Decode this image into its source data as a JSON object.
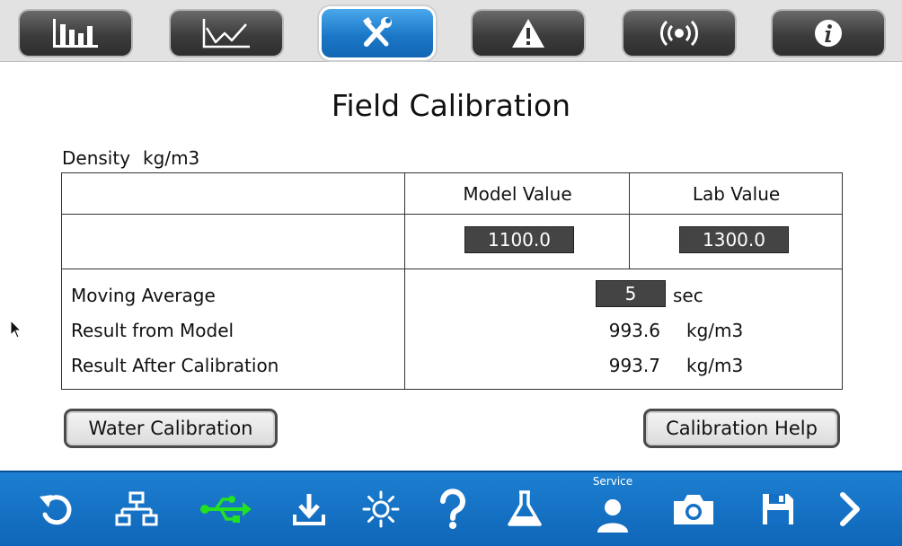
{
  "nav_tabs": [
    {
      "icon": "bar-chart-icon",
      "active": false
    },
    {
      "icon": "line-chart-icon",
      "active": false
    },
    {
      "icon": "tools-icon",
      "active": true
    },
    {
      "icon": "warning-icon",
      "active": false
    },
    {
      "icon": "signal-icon",
      "active": false
    },
    {
      "icon": "info-icon",
      "active": false
    }
  ],
  "page": {
    "title": "Field Calibration",
    "section_label": "Density",
    "section_unit": "kg/m3"
  },
  "table": {
    "headers": {
      "model": "Model Value",
      "lab": "Lab Value"
    },
    "model_value": "1100.0",
    "lab_value": "1300.0",
    "moving_average": {
      "label": "Moving Average",
      "value": "5",
      "unit": "sec"
    },
    "result_model": {
      "label": "Result from Model",
      "value": "993.6",
      "unit": "kg/m3"
    },
    "result_after": {
      "label": "Result After Calibration",
      "value": "993.7",
      "unit": "kg/m3"
    }
  },
  "buttons": {
    "water_calibration": "Water Calibration",
    "calibration_help": "Calibration Help"
  },
  "toolbar": {
    "service_label": "Service",
    "items": [
      "refresh-icon",
      "network-icon",
      "usb-icon",
      "download-icon",
      "brightness-icon",
      "help-icon",
      "flask-icon",
      "service-user-icon",
      "camera-icon",
      "save-icon",
      "next-icon"
    ],
    "usb_color": "#22e022"
  },
  "colors": {
    "active_tab": "#1b78c7",
    "toolbar_bg": "#1470c4",
    "value_box": "#444444"
  }
}
